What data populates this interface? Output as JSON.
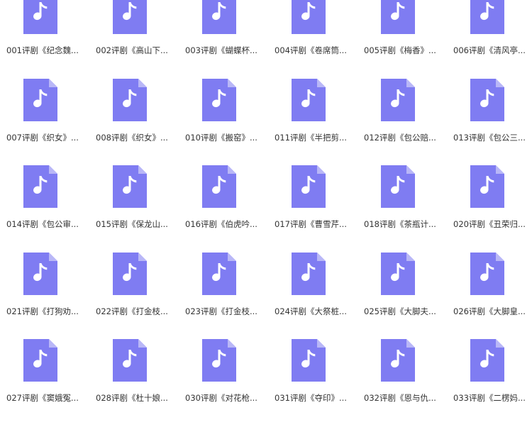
{
  "colors": {
    "icon_body": "#7f7cf2",
    "icon_fold": "#b9b7f7",
    "note": "#ffffff",
    "text": "#333333"
  },
  "icon": "music-file-icon",
  "files": [
    {
      "name": "001评剧《纪念魏..."
    },
    {
      "name": "002评剧《高山下..."
    },
    {
      "name": "003评剧《蝴蝶杯..."
    },
    {
      "name": "004评剧《卷席筒..."
    },
    {
      "name": "005评剧《梅香》..."
    },
    {
      "name": "006评剧《清风亭..."
    },
    {
      "name": "007评剧《织女》..."
    },
    {
      "name": "008评剧《织女》..."
    },
    {
      "name": "010评剧《搬窑》..."
    },
    {
      "name": "011评剧《半把剪..."
    },
    {
      "name": "012评剧《包公赔..."
    },
    {
      "name": "013评剧《包公三..."
    },
    {
      "name": "014评剧《包公审..."
    },
    {
      "name": "015评剧《保龙山..."
    },
    {
      "name": "016评剧《伯虎吟..."
    },
    {
      "name": "017评剧《曹雪芹..."
    },
    {
      "name": "018评剧《茶瓶计..."
    },
    {
      "name": "020评剧《丑荣归..."
    },
    {
      "name": "021评剧《打狗劝..."
    },
    {
      "name": "022评剧《打金枝..."
    },
    {
      "name": "023评剧《打金枝..."
    },
    {
      "name": "024评剧《大祭桩..."
    },
    {
      "name": "025评剧《大脚夫..."
    },
    {
      "name": "026评剧《大脚皇..."
    },
    {
      "name": "027评剧《窦娥冤..."
    },
    {
      "name": "028评剧《杜十娘..."
    },
    {
      "name": "030评剧《对花枪..."
    },
    {
      "name": "031评剧《夺印》..."
    },
    {
      "name": "032评剧《恩与仇..."
    },
    {
      "name": "033评剧《二楞妈..."
    }
  ]
}
